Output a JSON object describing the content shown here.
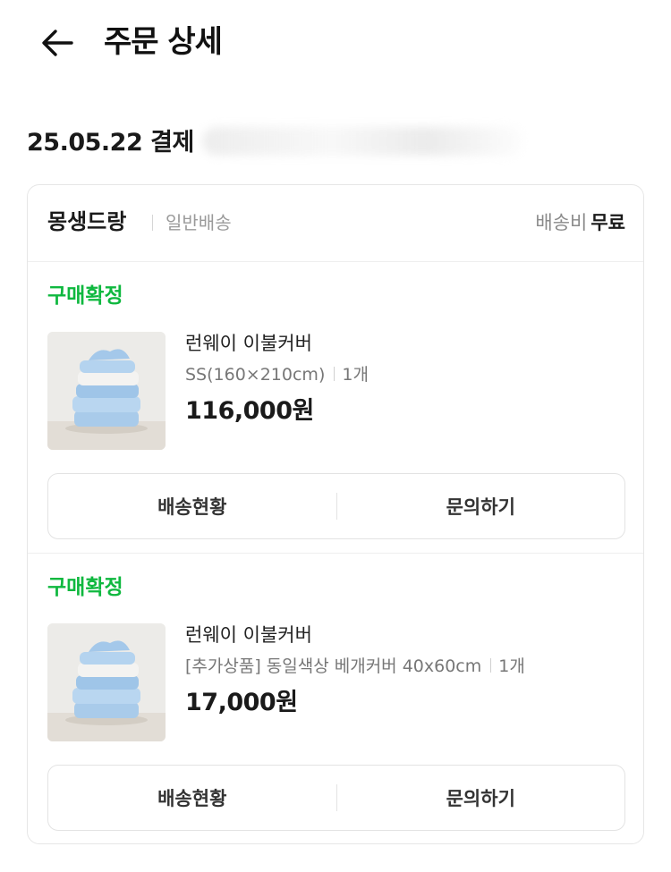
{
  "header": {
    "title": "주문 상세",
    "back_icon": "arrow-left-icon"
  },
  "order": {
    "date_label": "25.05.22 결제"
  },
  "seller": {
    "name": "몽생드랑",
    "shipping_type": "일반배송",
    "shipping_fee_label": "배송비",
    "shipping_fee_value": "무료"
  },
  "items": [
    {
      "status": "구매확정",
      "name": "런웨이 이불커버",
      "option": "SS(160×210cm)",
      "quantity": "1개",
      "price": "116,000원",
      "actions": {
        "tracking": "배송현황",
        "inquiry": "문의하기"
      }
    },
    {
      "status": "구매확정",
      "name": "런웨이 이불커버",
      "option": "[추가상품] 동일색상 베개커버 40x60cm",
      "quantity": "1개",
      "price": "17,000원",
      "actions": {
        "tracking": "배송현황",
        "inquiry": "문의하기"
      }
    }
  ],
  "colors": {
    "status_green": "#0fb83f",
    "text_primary": "#1a1a1a",
    "text_muted": "#8a8a8a",
    "border": "#e6e6e6"
  }
}
